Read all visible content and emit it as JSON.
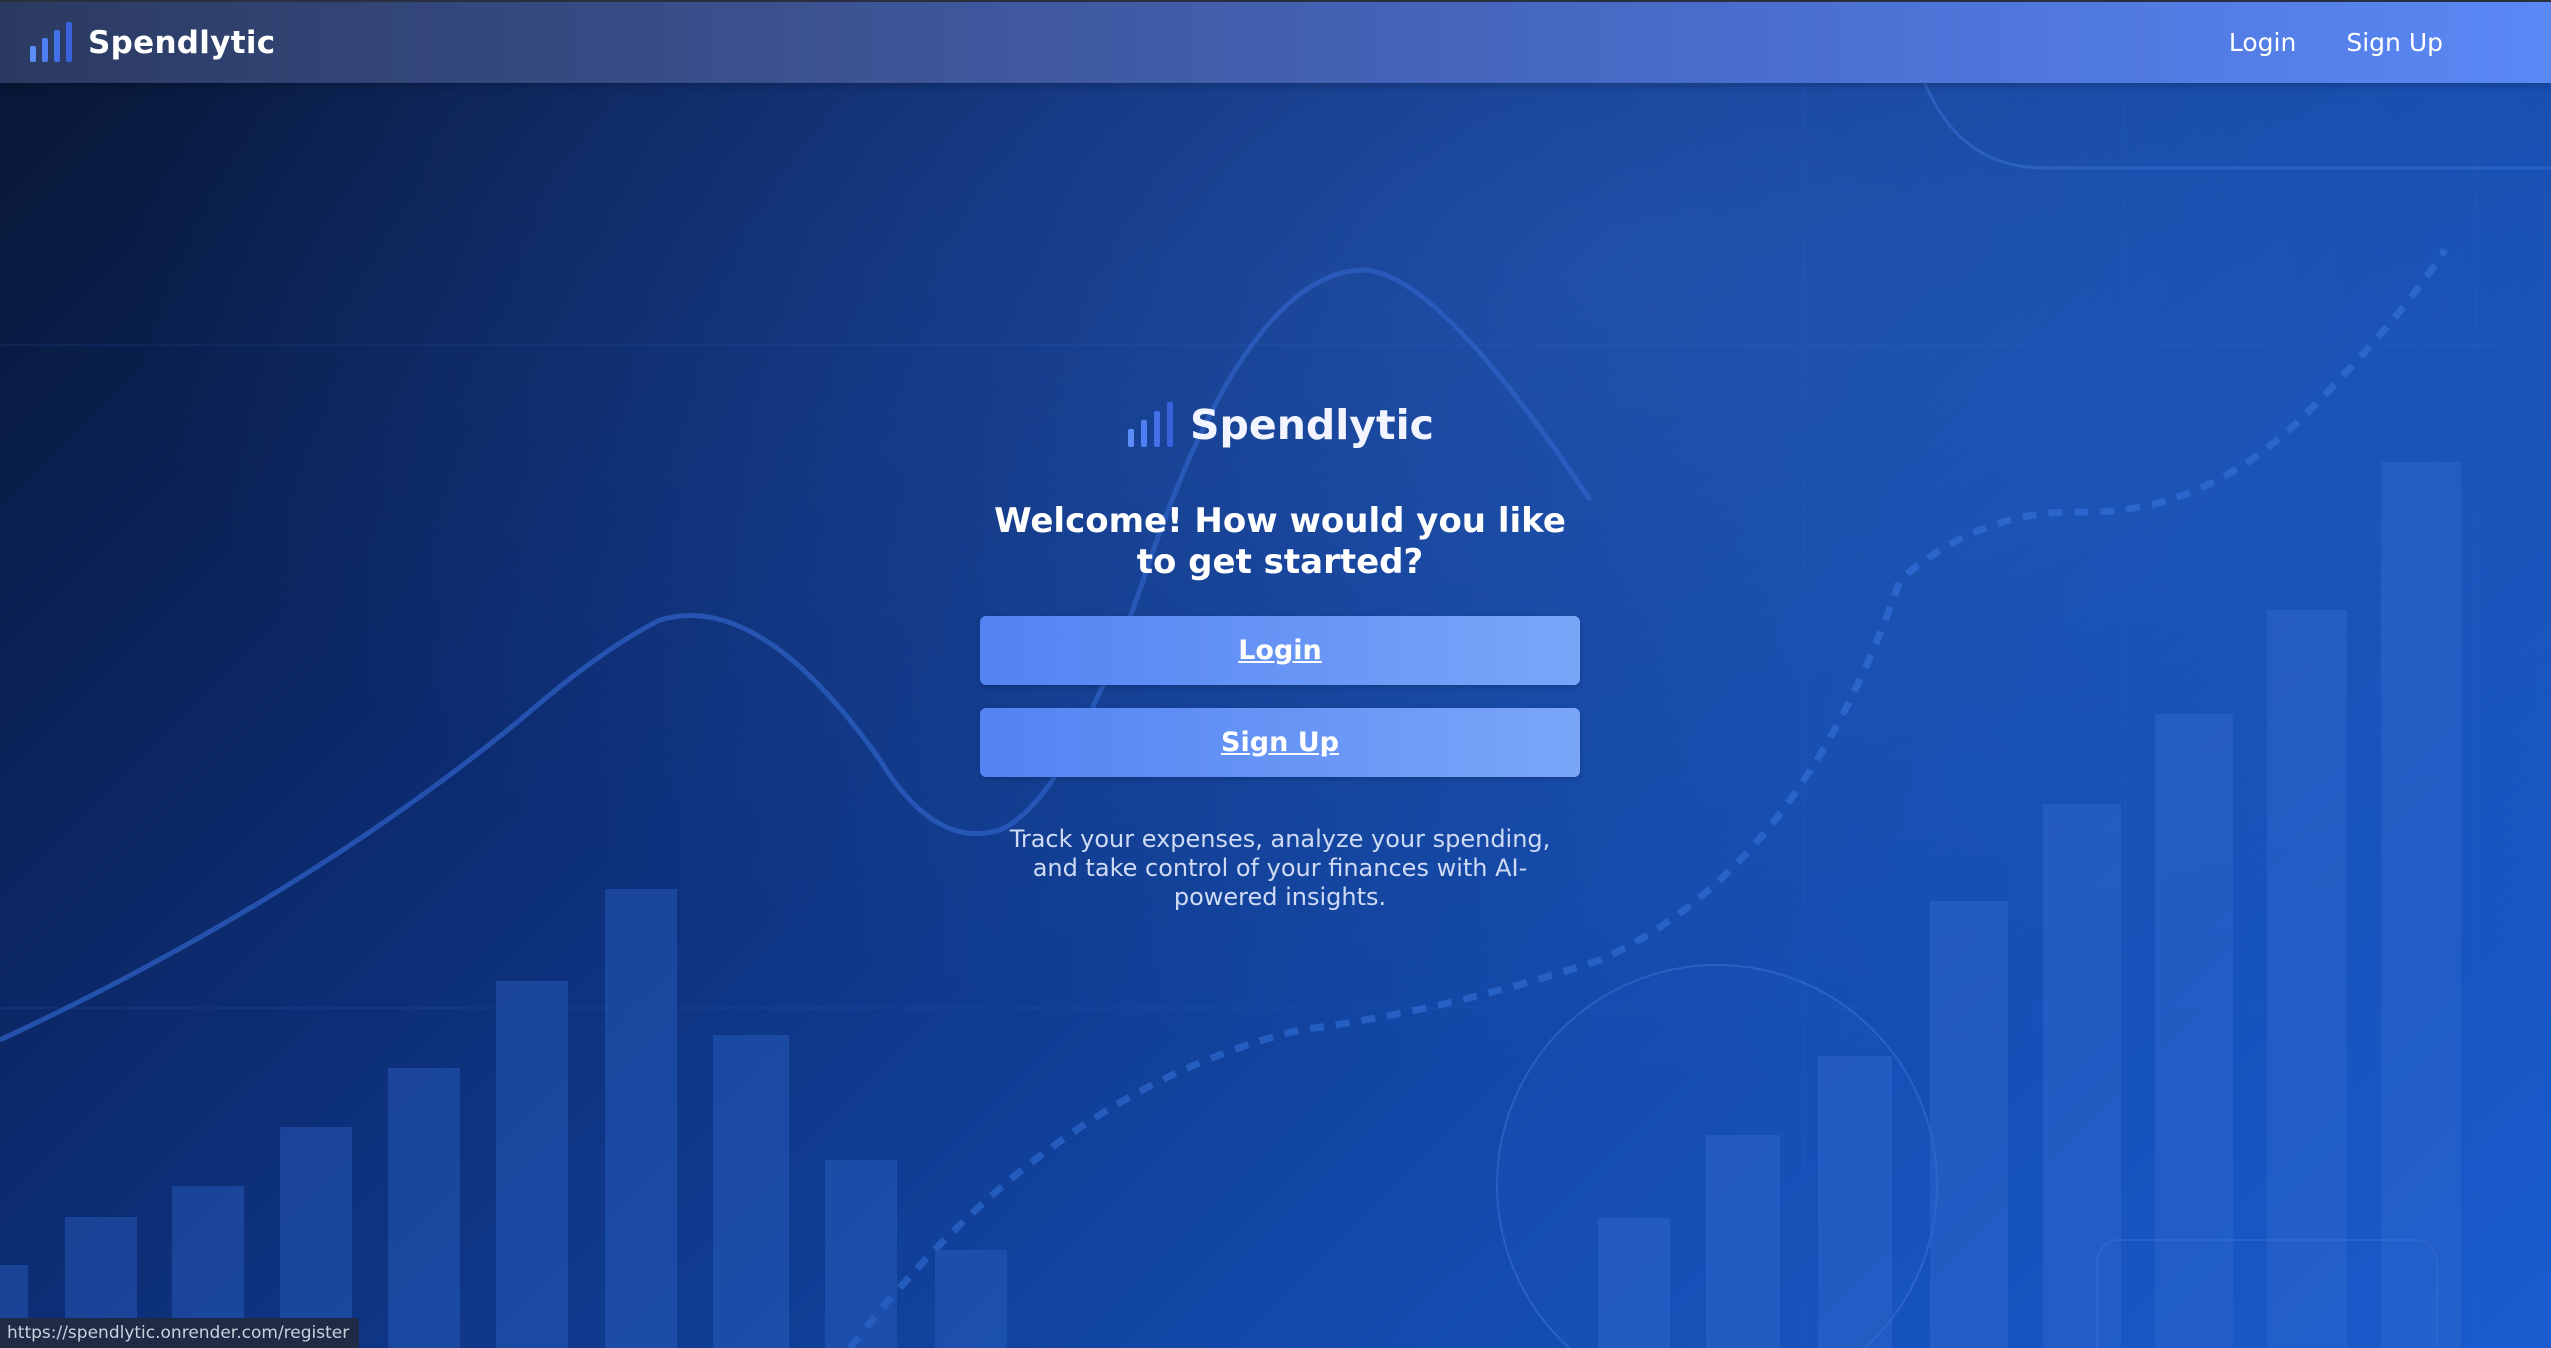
{
  "navbar": {
    "brand": "Spendlytic",
    "login_label": "Login",
    "signup_label": "Sign Up"
  },
  "card": {
    "brand": "Spendlytic",
    "welcome": "Welcome! How would you like to get started?",
    "login_button": "Login",
    "signup_button": "Sign Up",
    "tagline": "Track your expenses, analyze your spending, and take control of your finances with AI-powered insights."
  },
  "status_bar": {
    "url": "https://spendlytic.onrender.com/register"
  },
  "icons": {
    "brand_logo": "bar-chart-icon"
  },
  "colors": {
    "accent": "#5a88f5",
    "button": "#6b98f6",
    "background_dark": "#081633",
    "background_light": "#1a5ccf"
  }
}
